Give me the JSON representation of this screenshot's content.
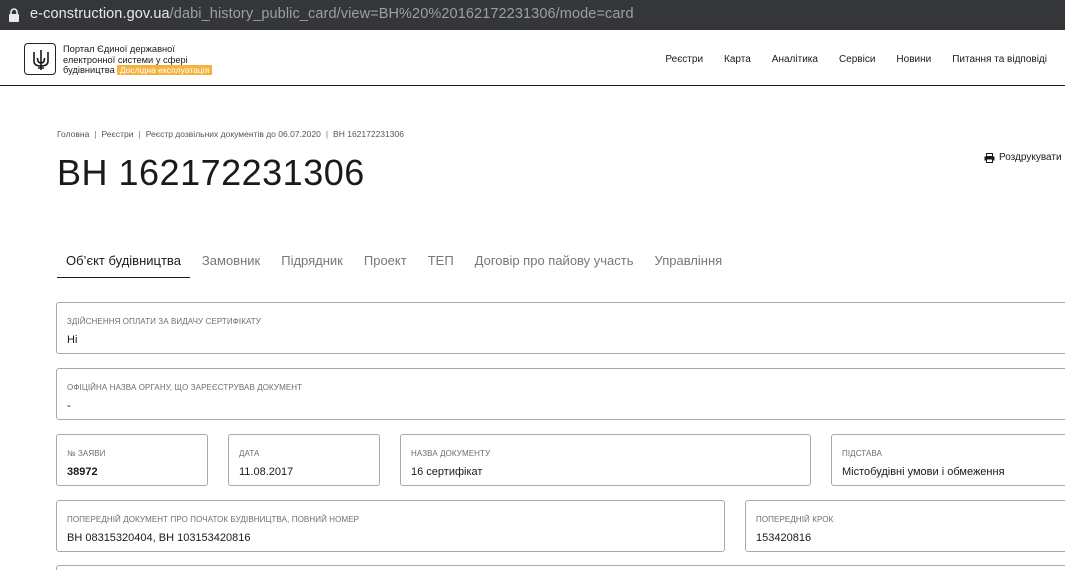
{
  "browser": {
    "url_host": "e-construction.gov.ua",
    "url_path": "/dabi_history_public_card/view=BH%20%20162172231306/mode=card"
  },
  "header": {
    "portal_name_line1": "Портал Єдиної державної",
    "portal_name_line2": "електронної системи у сфері",
    "portal_name_line3": "будівництва",
    "badge": "Дослідна експлуатація",
    "nav": [
      "Реєстри",
      "Карта",
      "Аналітика",
      "Сервіси",
      "Новини",
      "Питання та відповіді"
    ]
  },
  "breadcrumb": [
    "Головна",
    "Реєстри",
    "Реєстр дозвільних документів до 06.07.2020",
    "ВН 162172231306"
  ],
  "page": {
    "title": "ВН 162172231306",
    "print_label": "Роздрукувати"
  },
  "tabs": [
    "Об’єкт будівництва",
    "Замовник",
    "Підрядник",
    "Проект",
    "ТЕП",
    "Договір про пайову участь",
    "Управління"
  ],
  "fields": {
    "payment": {
      "label": "Здійснення оплати за видачу сертифікату",
      "value": "Ні"
    },
    "authority": {
      "label": "Офіційна назва органу, що зареєстрував документ",
      "value": "-"
    },
    "app_no": {
      "label": "№ заяви",
      "value": "38972"
    },
    "date": {
      "label": "Дата",
      "value": "11.08.2017"
    },
    "doc_name": {
      "label": "Назва документу",
      "value": "16 сертифікат"
    },
    "basis": {
      "label": "Підстава",
      "value": "Містобудівні умови і обмеження"
    },
    "prev_doc": {
      "label": "Попередній документ про початок будівництва, повний номер",
      "value": "ВН 08315320404, ВН 103153420816"
    },
    "prev_step": {
      "label": "Попередній крок",
      "value": "153420816"
    }
  }
}
